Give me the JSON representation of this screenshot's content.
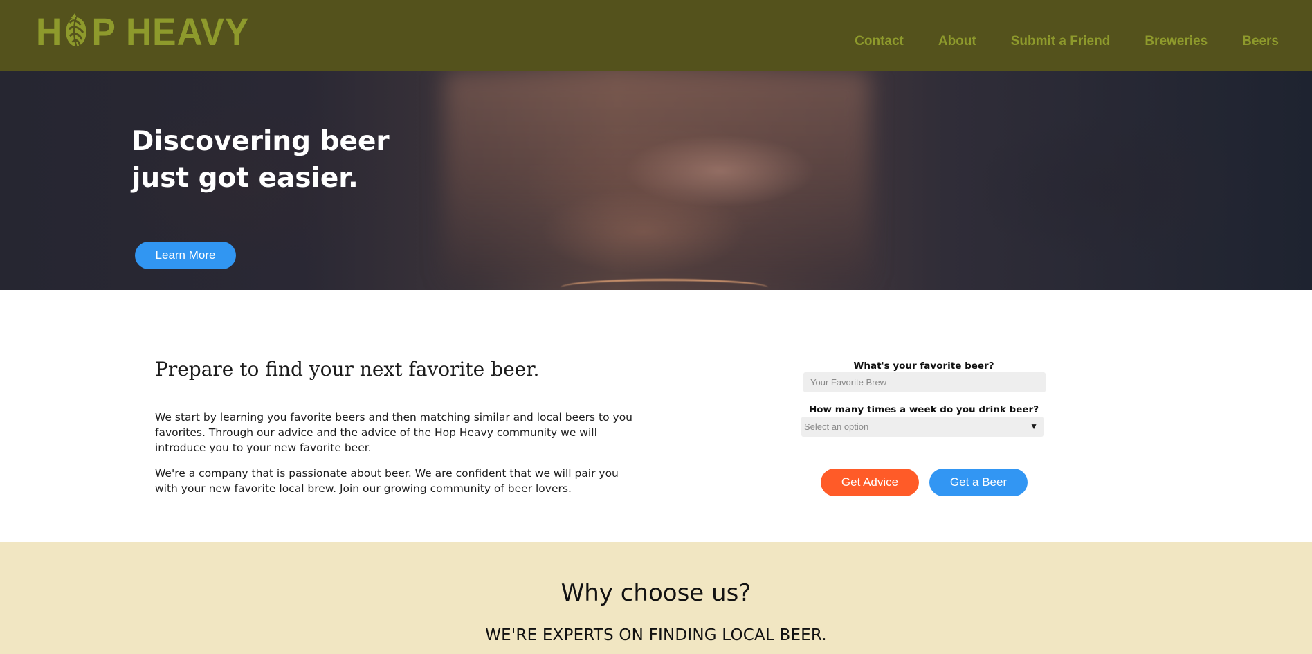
{
  "header": {
    "logo_text": "HOP HEAVY",
    "logo_icon": "hop-leaf-icon",
    "nav_items": [
      "Contact",
      "About",
      "Submit a Friend",
      "Breweries",
      "Beers"
    ],
    "colors": {
      "header_bg": "#54521c",
      "nav_text": "#8e9a2c"
    }
  },
  "hero": {
    "title_line_1": "Discovering beer",
    "title_line_2": "just got easier.",
    "cta_label": "Learn More",
    "cta_color": "#3196f2"
  },
  "intro": {
    "heading": "Prepare to find your next favorite beer.",
    "paragraph_1": "We start by learning you favorite beers and then matching similar and local beers to you favorites. Through our advice and the advice of the Hop Heavy community we will introduce you to your new favorite beer.",
    "paragraph_2": "We're a company that is passionate about beer. We are confident that we will pair you with your new favorite local brew. Join our growing community of beer lovers."
  },
  "form": {
    "favorite_label": "What's your favorite beer?",
    "favorite_placeholder": "Your Favorite Brew",
    "frequency_label": "How many times a week do you drink beer?",
    "frequency_selected": "Select an option",
    "dropdown_icon": "dropdown-arrow-icon",
    "advice_button": "Get Advice",
    "beer_button": "Get a Beer",
    "colors": {
      "advice": "#ff5b28",
      "beer": "#3296f3"
    }
  },
  "why": {
    "title": "Why choose us?",
    "subtitle": "WE'RE EXPERTS ON FINDING LOCAL BEER.",
    "background": "#f1e6c2"
  }
}
